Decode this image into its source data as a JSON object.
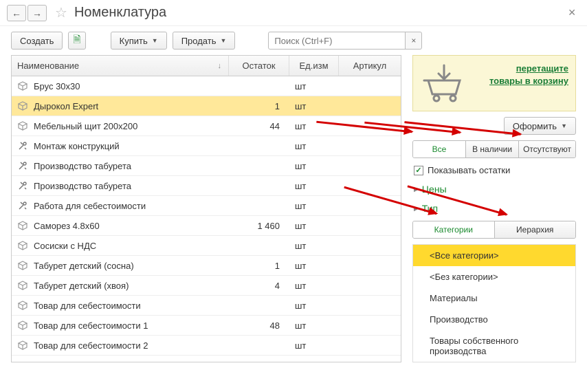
{
  "title": "Номенклатура",
  "toolbar": {
    "create": "Создать",
    "buy": "Купить",
    "sell": "Продать",
    "search_placeholder": "Поиск (Ctrl+F)"
  },
  "columns": {
    "name": "Наименование",
    "rest": "Остаток",
    "unit": "Ед.изм",
    "art": "Артикул"
  },
  "rows": [
    {
      "icon": "cube",
      "name": "Брус 30х30",
      "rest": "",
      "unit": "шт"
    },
    {
      "icon": "cube",
      "name": "Дырокол Expert",
      "rest": "1",
      "unit": "шт",
      "selected": true
    },
    {
      "icon": "cube",
      "name": "Мебельный щит 200х200",
      "rest": "44",
      "unit": "шт"
    },
    {
      "icon": "tools",
      "name": "Монтаж конструкций",
      "rest": "",
      "unit": "шт"
    },
    {
      "icon": "tools",
      "name": "Производство табурета",
      "rest": "",
      "unit": "шт"
    },
    {
      "icon": "tools",
      "name": "Производство табурета",
      "rest": "",
      "unit": "шт"
    },
    {
      "icon": "tools",
      "name": "Работа для себестоимости",
      "rest": "",
      "unit": "шт"
    },
    {
      "icon": "cube",
      "name": "Саморез 4.8х60",
      "rest": "1 460",
      "unit": "шт"
    },
    {
      "icon": "cube",
      "name": "Сосиски с НДС",
      "rest": "",
      "unit": "шт"
    },
    {
      "icon": "cube",
      "name": "Табурет детский (сосна)",
      "rest": "1",
      "unit": "шт"
    },
    {
      "icon": "cube",
      "name": "Табурет детский (хвоя)",
      "rest": "4",
      "unit": "шт"
    },
    {
      "icon": "cube",
      "name": "Товар для себестоимости",
      "rest": "",
      "unit": "шт"
    },
    {
      "icon": "cube",
      "name": "Товар для себестоимости 1",
      "rest": "48",
      "unit": "шт"
    },
    {
      "icon": "cube",
      "name": "Товар для себестоимости 2",
      "rest": "",
      "unit": "шт"
    }
  ],
  "cart": {
    "link_l1": "перетащите",
    "link_l2": "товары в корзину",
    "checkout": "Оформить"
  },
  "filters": {
    "all": "Все",
    "instock": "В наличии",
    "absent": "Отсутствуют",
    "show_rest": "Показывать остатки",
    "prices": "Цены",
    "type": "Тип",
    "categories": "Категории",
    "hierarchy": "Иерархия"
  },
  "categories": [
    "<Все категории>",
    "<Без категории>",
    "Материалы",
    "Производство",
    "Товары собственного производства"
  ]
}
